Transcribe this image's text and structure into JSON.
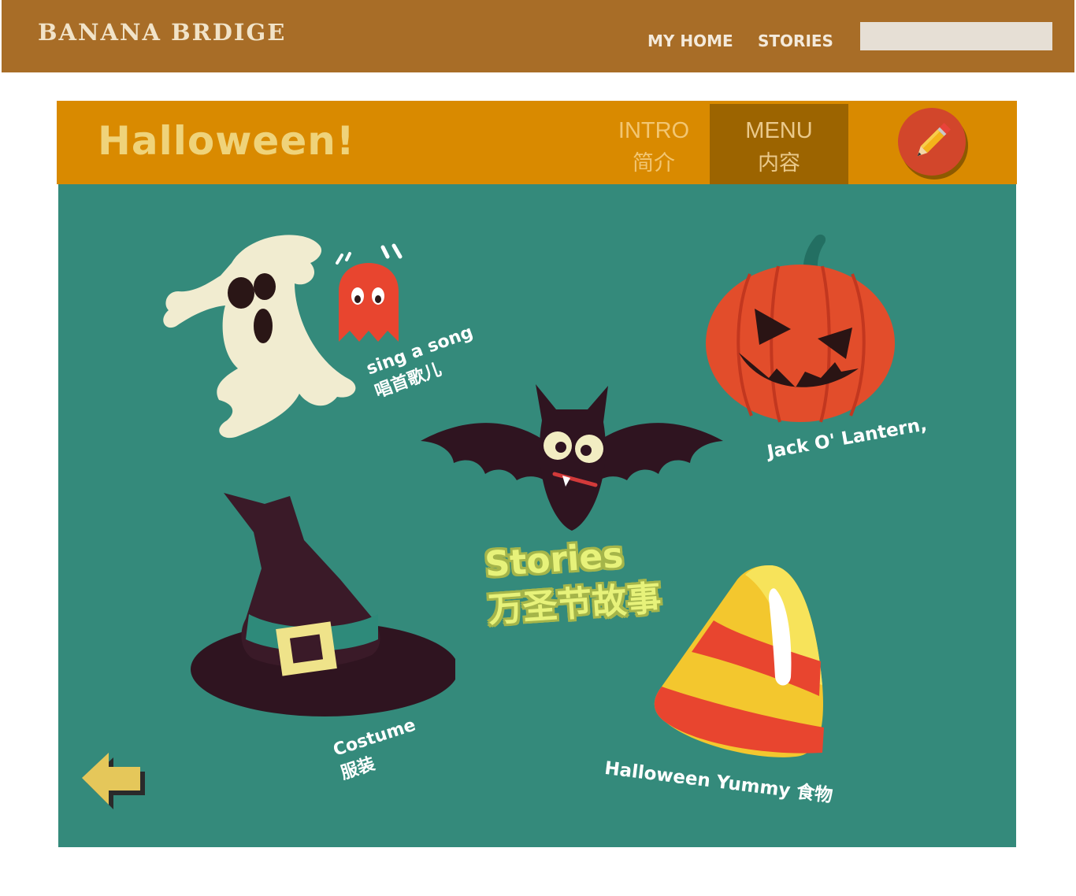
{
  "site": {
    "brand": "BANANA BRDIGE",
    "nav": {
      "home": "MY HOME",
      "stories": "STORIES"
    },
    "search_value": ""
  },
  "panel": {
    "title": "Halloween!",
    "tabs": [
      {
        "en": "INTRO",
        "zh": "简介",
        "active": false
      },
      {
        "en": "MENU",
        "zh": "内容",
        "active": true
      }
    ]
  },
  "menu": {
    "song": {
      "en": "sing a song",
      "zh": "唱首歌儿"
    },
    "jack": {
      "en": "Jack O' Lantern,"
    },
    "stories": {
      "en": "Stories",
      "zh": "万圣节故事"
    },
    "costume": {
      "en": "Costume",
      "zh": "服装"
    },
    "yummy": {
      "en": "Halloween Yummy 食物"
    }
  },
  "icons": {
    "ghost": "ghost-icon",
    "pacman_ghost": "red-ghost-icon",
    "pumpkin": "pumpkin-icon",
    "bat": "bat-icon",
    "hat": "witch-hat-icon",
    "candy": "candy-corn-icon",
    "back": "back-arrow-icon",
    "edit": "pencil-icon"
  },
  "colors": {
    "site_bar": "#a86d27",
    "panel_header": "#d98a00",
    "active_tab": "#9c6400",
    "stage": "#348a7b",
    "pencil_button": "#d2462b",
    "stories_text": "#e7f27a"
  }
}
